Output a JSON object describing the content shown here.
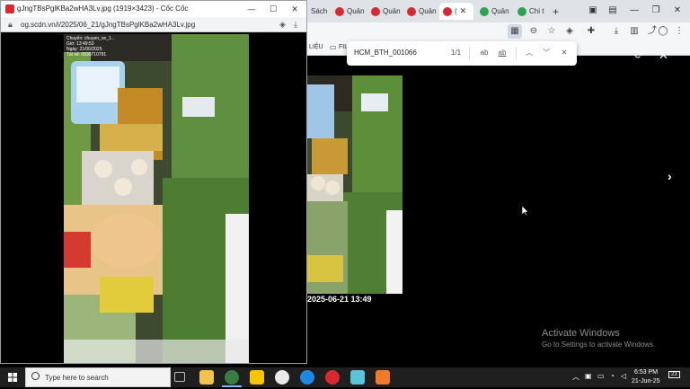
{
  "main_browser": {
    "tabs": [
      {
        "label": "Sách",
        "favicon": "red",
        "active": false
      },
      {
        "label": "Quản",
        "favicon": "red",
        "active": false
      },
      {
        "label": "Quản",
        "favicon": "red",
        "active": false
      },
      {
        "label": "Quản",
        "favicon": "red",
        "active": false
      },
      {
        "label": "(",
        "favicon": "red",
        "active": true
      },
      {
        "label": "Quản",
        "favicon": "green",
        "active": false
      },
      {
        "label": "Chi t",
        "favicon": "green",
        "active": false
      }
    ],
    "new_tab_label": "+",
    "bookmarks": {
      "item1": "LIỆU",
      "item2": "FIL"
    },
    "find_bar": {
      "query": "HCM_BTH_001066",
      "count": "1/1",
      "match_case": "ab",
      "whole_word": "ab"
    },
    "photo_timestamp": "2025-06-21 13:49",
    "activate_windows": {
      "title": "Activate Windows",
      "subtitle": "Go to Settings to activate Windows."
    }
  },
  "popup": {
    "title": "gJngTBsPglKBa2wHA3Lv.jpg (1919×3423) - Cốc Cốc",
    "url": "og.scdn.vn/i/2025/06_21/gJngTBsPglKBa2wHA3Lv.jpg",
    "photo_stamp": [
      "Chuyến: chuyen_xe_1...",
      "Giờ: 13:49:53",
      "Ngày: 21/06/2025",
      "Tài xế: 0939710791"
    ]
  },
  "taskbar": {
    "search_placeholder": "Type here to search",
    "time": "6:53 PM",
    "date": "21-Jun-25",
    "notification_count": "23"
  }
}
